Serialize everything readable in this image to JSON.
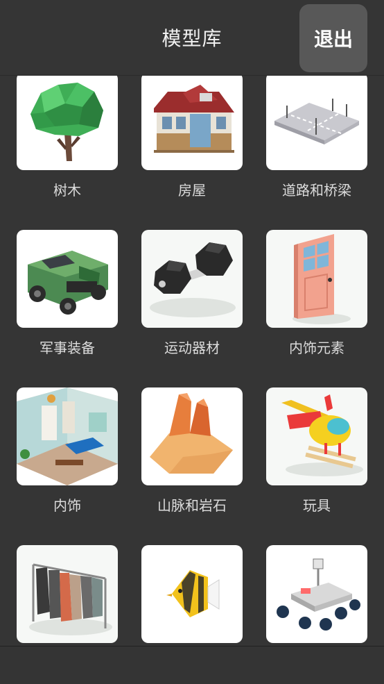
{
  "header": {
    "title": "模型库",
    "exit_label": "退出"
  },
  "categories": [
    {
      "label": "树木",
      "icon": "tree-icon"
    },
    {
      "label": "房屋",
      "icon": "house-icon"
    },
    {
      "label": "道路和桥梁",
      "icon": "road-icon"
    },
    {
      "label": "军事装备",
      "icon": "military-vehicle-icon"
    },
    {
      "label": "运动器材",
      "icon": "dumbbell-icon"
    },
    {
      "label": "内饰元素",
      "icon": "door-icon"
    },
    {
      "label": "内饰",
      "icon": "interior-room-icon"
    },
    {
      "label": "山脉和岩石",
      "icon": "rock-icon"
    },
    {
      "label": "玩具",
      "icon": "toy-helicopter-icon"
    },
    {
      "label": "",
      "icon": "clothes-rack-icon"
    },
    {
      "label": "",
      "icon": "fish-icon"
    },
    {
      "label": "",
      "icon": "rover-icon"
    }
  ]
}
